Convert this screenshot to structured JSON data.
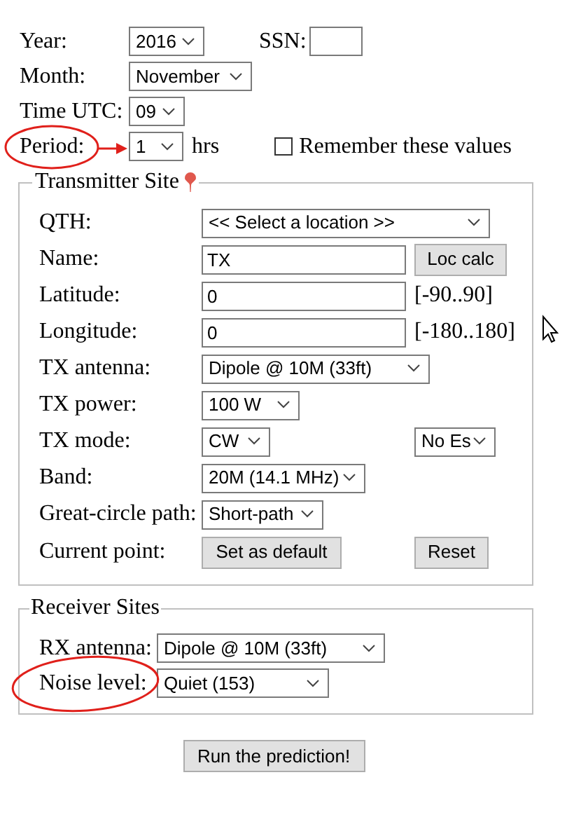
{
  "general": {
    "year": {
      "label": "Year:",
      "value": "2016"
    },
    "ssn": {
      "label": "SSN:"
    },
    "month": {
      "label": "Month:",
      "value": "November"
    },
    "time_utc": {
      "label": "Time UTC:",
      "value": "09"
    },
    "period": {
      "label": "Period:",
      "value": "1",
      "unit": "hrs"
    },
    "remember": {
      "label": "Remember these values",
      "checked": false
    }
  },
  "transmitter": {
    "legend": "Transmitter Site",
    "rows": [
      {
        "kind": "select",
        "label": "QTH:",
        "value": "<< Select a location >>"
      },
      {
        "kind": "input",
        "label": "Name:",
        "value": "TX",
        "extra": {
          "kind": "button",
          "text": "Loc calc"
        }
      },
      {
        "kind": "input",
        "label": "Latitude:",
        "value": "0",
        "extra": {
          "kind": "text",
          "text": "[-90..90]"
        }
      },
      {
        "kind": "input",
        "label": "Longitude:",
        "value": "0",
        "extra": {
          "kind": "text",
          "text": "[-180..180]"
        }
      },
      {
        "kind": "select",
        "label": "TX antenna:",
        "value": "Dipole @ 10M (33ft)"
      },
      {
        "kind": "select",
        "label": "TX power:",
        "value": "100 W"
      },
      {
        "kind": "select",
        "label": "TX mode:",
        "value": "CW",
        "extra": {
          "kind": "select",
          "text": "No Es"
        }
      },
      {
        "kind": "select",
        "label": "Band:",
        "value": "20M (14.1 MHz)"
      },
      {
        "kind": "select",
        "label": "Great-circle path:",
        "value": "Short-path"
      },
      {
        "kind": "button",
        "label": "Current point:",
        "value": "Set as default",
        "extra": {
          "kind": "button",
          "text": "Reset"
        }
      }
    ]
  },
  "receiver": {
    "legend": "Receiver Sites",
    "rows": [
      {
        "kind": "select",
        "label": "RX antenna:",
        "value": "Dipole @ 10M (33ft)"
      },
      {
        "kind": "select",
        "label": "Noise level:",
        "value": "Quiet (153)"
      }
    ]
  },
  "run_button": "Run the prediction!"
}
